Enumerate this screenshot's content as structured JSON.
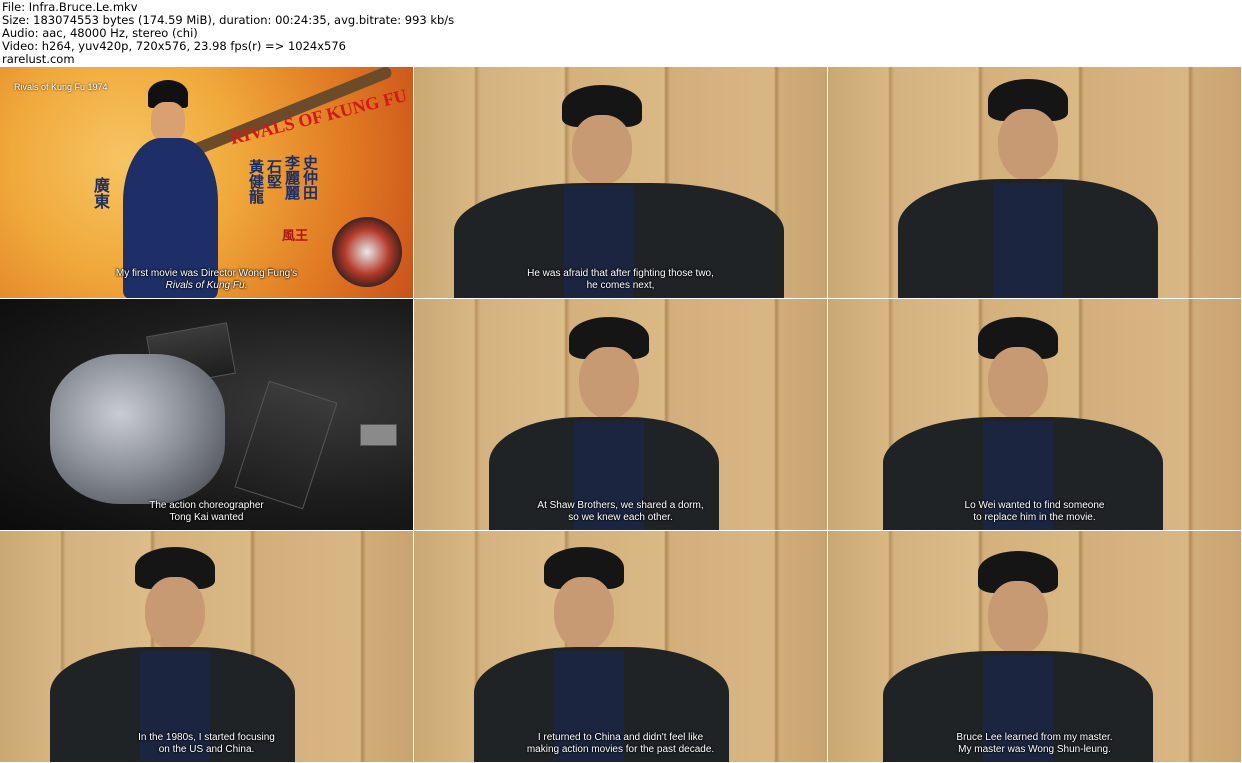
{
  "header": {
    "file_line": "File: Infra.Bruce.Le.mkv",
    "size_line": "Size: 183074553 bytes (174.59 MiB), duration: 00:24:35, avg.bitrate: 993 kb/s",
    "audio_line": "Audio: aac, 48000 Hz, stereo (chi)",
    "video_line": "Video: h264, yuv420p, 720x576, 23.98 fps(r) => 1024x576",
    "site_line": "rarelust.com"
  },
  "thumbnails": [
    {
      "kind": "poster",
      "caption_label": "Rivals of Kung Fu 1974",
      "poster_english_title": "RIVALS OF KUNG FU",
      "poster_cn_1": "史仲田",
      "poster_cn_2": "李麗麗",
      "poster_cn_3": "石堅",
      "poster_cn_4": "黃健龍",
      "poster_cn_5": "廣東",
      "poster_cn_6": "風王",
      "subtitle_line1": "My first movie was Director Wong Fung's",
      "subtitle_line2": "Rivals of Kung Fu."
    },
    {
      "kind": "interview",
      "subtitle_line1": "He was afraid that after fighting those two,",
      "subtitle_line2": "he comes next,"
    },
    {
      "kind": "interview",
      "subtitle_line1": "",
      "subtitle_line2": ""
    },
    {
      "kind": "pedal",
      "subtitle_line1": "The action choreographer",
      "subtitle_line2": "Tong Kai wanted"
    },
    {
      "kind": "interview",
      "subtitle_line1": "At Shaw Brothers, we shared a dorm,",
      "subtitle_line2": "so we knew each other."
    },
    {
      "kind": "interview",
      "subtitle_line1": "Lo Wei wanted to find someone",
      "subtitle_line2": "to replace him in the movie."
    },
    {
      "kind": "interview",
      "subtitle_line1": "In the 1980s, I started focusing",
      "subtitle_line2": "on the US and China."
    },
    {
      "kind": "interview",
      "subtitle_line1": "I returned to China and didn't feel like",
      "subtitle_line2": "making action movies for the past decade."
    },
    {
      "kind": "interview",
      "subtitle_line1": "Bruce Lee learned from my master.",
      "subtitle_line2": "My master was Wong Shun-leung."
    }
  ]
}
